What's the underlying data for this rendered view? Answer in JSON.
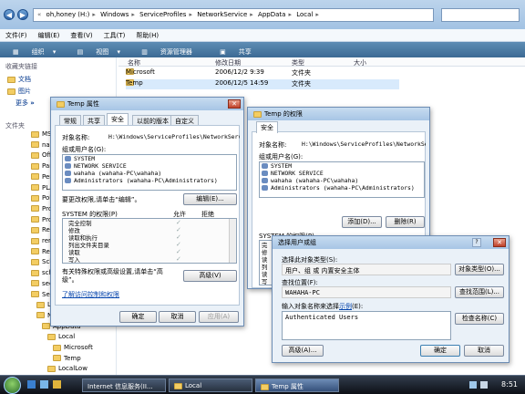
{
  "explorer": {
    "address": [
      "oh,honey (H:)",
      "Windows",
      "ServiceProfiles",
      "NetworkService",
      "AppData",
      "Local"
    ],
    "menu": [
      "文件(F)",
      "编辑(E)",
      "查看(V)",
      "工具(T)",
      "帮助(H)"
    ],
    "toolbar": [
      "组织",
      "视图",
      "资源管理器",
      "共享"
    ],
    "nav": {
      "favorites_head": "收藏夹链接",
      "links": [
        "文档",
        "图片",
        "更多"
      ],
      "more_arrow": "»",
      "folders_head": "文件夹",
      "tree": [
        "MS",
        "nap",
        "Off",
        "Par",
        "Per",
        "PLA",
        "Pol",
        "Pro",
        "Pro",
        "Reg",
        "rem",
        "Res",
        "Sch",
        "sch",
        "sec",
        "Ser",
        "L",
        "N",
        "AppData",
        "Local",
        "Microsoft",
        "Temp",
        "LocalLow"
      ]
    },
    "columns": [
      "名称",
      "修改日期",
      "类型",
      "大小"
    ],
    "files": [
      {
        "name": "Microsoft",
        "date": "2006/12/2 9:39",
        "type": "文件夹"
      },
      {
        "name": "Temp",
        "date": "2006/12/5 14:59",
        "type": "文件夹"
      }
    ]
  },
  "props": {
    "title": "Temp 属性",
    "tabs": [
      "常规",
      "共享",
      "安全",
      "以前的版本",
      "自定义"
    ],
    "object_label": "对象名称:",
    "object_value": "H:\\Windows\\ServiceProfiles\\NetworkServic",
    "group_label": "组或用户名(G):",
    "users": [
      "SYSTEM",
      "NETWORK SERVICE",
      "wahaha (wahaha-PC\\wahaha)",
      "Administrators (wahaha-PC\\Administrators)"
    ],
    "change_hint": "要更改权限,请单击“编辑”。",
    "edit_btn": "编辑(E)...",
    "perm_label": "SYSTEM 的权限(P)",
    "allow": "允许",
    "deny": "拒绝",
    "perms": [
      "完全控制",
      "修改",
      "读取和执行",
      "列出文件夹目录",
      "读取",
      "写入"
    ],
    "special_hint": "有关特殊权限或高级设置,请单击“高级”。",
    "advanced_btn": "高级(V)",
    "learn_link": "了解访问控制和权限",
    "ok": "确定",
    "cancel": "取消",
    "apply": "应用(A)"
  },
  "perm_dialog": {
    "title": "Temp 的权限",
    "tab": "安全",
    "object_label": "对象名称:",
    "object_value": "H:\\Windows\\ServiceProfiles\\NetworkServic",
    "group_label": "组或用户名(G):",
    "users": [
      "SYSTEM",
      "NETWORK SERVICE",
      "wahaha (wahaha-PC\\wahaha)",
      "Administrators (wahaha-PC\\Administrators)"
    ],
    "add_btn": "添加(D)...",
    "remove_btn": "删除(R)",
    "perm_label": "SYSTEM 的权限(P)",
    "partial": [
      "完",
      "修",
      "读",
      "列",
      "读",
      "写"
    ]
  },
  "select_dialog": {
    "title": "选择用户或组",
    "type_label": "选择此对象类型(S):",
    "type_value": "用户、组 或 内置安全主体",
    "type_btn": "对象类型(O)...",
    "loc_label": "查找位置(F):",
    "loc_value": "WAHAHA-PC",
    "loc_btn": "查找范围(L)...",
    "name_label": "输入对象名称来选择",
    "example": "示例",
    "name_label_end": "(E):",
    "name_value": "Authenticated Users",
    "check_btn": "检查名称(C)",
    "advanced_btn": "高级(A)...",
    "ok": "确定",
    "cancel": "取消"
  },
  "taskbar": {
    "tasks": [
      "Internet 信息服务(II...",
      "Local",
      "Temp 属性"
    ],
    "clock": "8:51"
  }
}
